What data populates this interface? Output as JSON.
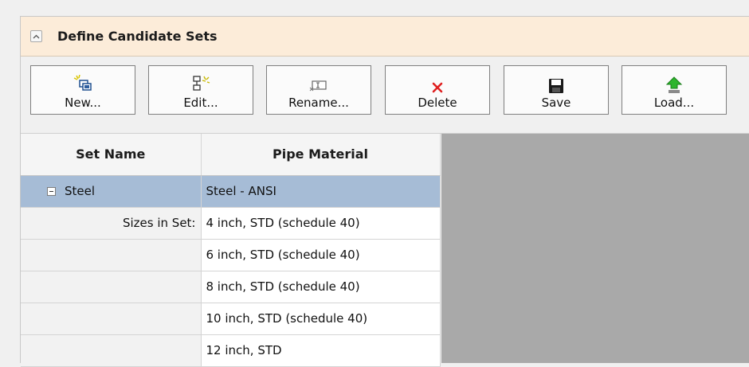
{
  "panel": {
    "title": "Define Candidate Sets"
  },
  "toolbar": {
    "new_label": "New...",
    "edit_label": "Edit...",
    "rename_label": "Rename...",
    "delete_label": "Delete",
    "save_label": "Save",
    "load_label": "Load..."
  },
  "icons": {
    "new": "new-set-icon",
    "edit": "edit-set-icon",
    "rename": "rename-icon",
    "delete": "red-x-icon",
    "save": "floppy-disk-icon",
    "load": "green-up-arrow-icon",
    "collapse": "chevron-up-icon"
  },
  "grid": {
    "columns": [
      "Set Name",
      "Pipe Material"
    ],
    "set": {
      "name": "Steel",
      "material": "Steel - ANSI",
      "sizes_label": "Sizes in Set:",
      "sizes": [
        "4 inch, STD (schedule 40)",
        "6 inch, STD (schedule 40)",
        "8 inch, STD (schedule 40)",
        "10 inch, STD (schedule 40)",
        "12 inch, STD"
      ]
    }
  },
  "colors": {
    "header_bg": "#fcecd9",
    "selected_row": "#a6bcd6",
    "empty_area": "#a9a9a9"
  }
}
